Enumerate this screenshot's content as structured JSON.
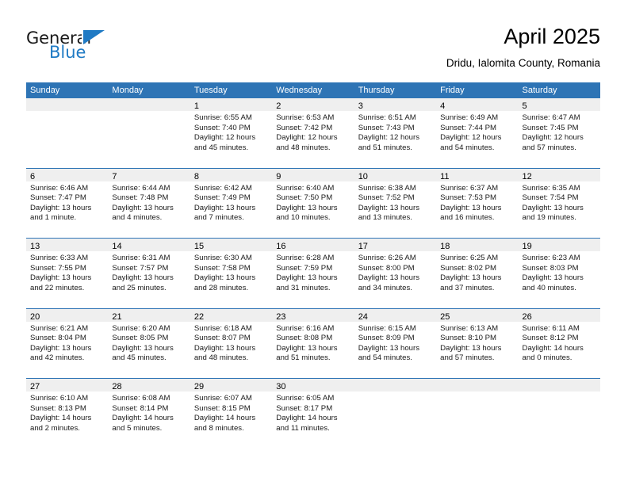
{
  "brand": {
    "name_part1": "General",
    "name_part2": "Blue",
    "accent_color": "#1f7ac4"
  },
  "header": {
    "title": "April 2025",
    "subtitle": "Dridu, Ialomita County, Romania"
  },
  "theme": {
    "header_blue": "#2e74b5",
    "day_band_gray": "#efefef"
  },
  "weekdays": [
    "Sunday",
    "Monday",
    "Tuesday",
    "Wednesday",
    "Thursday",
    "Friday",
    "Saturday"
  ],
  "weeks": [
    [
      {
        "empty": true
      },
      {
        "empty": true
      },
      {
        "day": "1",
        "sunrise": "Sunrise: 6:55 AM",
        "sunset": "Sunset: 7:40 PM",
        "daylight": "Daylight: 12 hours and 45 minutes."
      },
      {
        "day": "2",
        "sunrise": "Sunrise: 6:53 AM",
        "sunset": "Sunset: 7:42 PM",
        "daylight": "Daylight: 12 hours and 48 minutes."
      },
      {
        "day": "3",
        "sunrise": "Sunrise: 6:51 AM",
        "sunset": "Sunset: 7:43 PM",
        "daylight": "Daylight: 12 hours and 51 minutes."
      },
      {
        "day": "4",
        "sunrise": "Sunrise: 6:49 AM",
        "sunset": "Sunset: 7:44 PM",
        "daylight": "Daylight: 12 hours and 54 minutes."
      },
      {
        "day": "5",
        "sunrise": "Sunrise: 6:47 AM",
        "sunset": "Sunset: 7:45 PM",
        "daylight": "Daylight: 12 hours and 57 minutes."
      }
    ],
    [
      {
        "day": "6",
        "sunrise": "Sunrise: 6:46 AM",
        "sunset": "Sunset: 7:47 PM",
        "daylight": "Daylight: 13 hours and 1 minute."
      },
      {
        "day": "7",
        "sunrise": "Sunrise: 6:44 AM",
        "sunset": "Sunset: 7:48 PM",
        "daylight": "Daylight: 13 hours and 4 minutes."
      },
      {
        "day": "8",
        "sunrise": "Sunrise: 6:42 AM",
        "sunset": "Sunset: 7:49 PM",
        "daylight": "Daylight: 13 hours and 7 minutes."
      },
      {
        "day": "9",
        "sunrise": "Sunrise: 6:40 AM",
        "sunset": "Sunset: 7:50 PM",
        "daylight": "Daylight: 13 hours and 10 minutes."
      },
      {
        "day": "10",
        "sunrise": "Sunrise: 6:38 AM",
        "sunset": "Sunset: 7:52 PM",
        "daylight": "Daylight: 13 hours and 13 minutes."
      },
      {
        "day": "11",
        "sunrise": "Sunrise: 6:37 AM",
        "sunset": "Sunset: 7:53 PM",
        "daylight": "Daylight: 13 hours and 16 minutes."
      },
      {
        "day": "12",
        "sunrise": "Sunrise: 6:35 AM",
        "sunset": "Sunset: 7:54 PM",
        "daylight": "Daylight: 13 hours and 19 minutes."
      }
    ],
    [
      {
        "day": "13",
        "sunrise": "Sunrise: 6:33 AM",
        "sunset": "Sunset: 7:55 PM",
        "daylight": "Daylight: 13 hours and 22 minutes."
      },
      {
        "day": "14",
        "sunrise": "Sunrise: 6:31 AM",
        "sunset": "Sunset: 7:57 PM",
        "daylight": "Daylight: 13 hours and 25 minutes."
      },
      {
        "day": "15",
        "sunrise": "Sunrise: 6:30 AM",
        "sunset": "Sunset: 7:58 PM",
        "daylight": "Daylight: 13 hours and 28 minutes."
      },
      {
        "day": "16",
        "sunrise": "Sunrise: 6:28 AM",
        "sunset": "Sunset: 7:59 PM",
        "daylight": "Daylight: 13 hours and 31 minutes."
      },
      {
        "day": "17",
        "sunrise": "Sunrise: 6:26 AM",
        "sunset": "Sunset: 8:00 PM",
        "daylight": "Daylight: 13 hours and 34 minutes."
      },
      {
        "day": "18",
        "sunrise": "Sunrise: 6:25 AM",
        "sunset": "Sunset: 8:02 PM",
        "daylight": "Daylight: 13 hours and 37 minutes."
      },
      {
        "day": "19",
        "sunrise": "Sunrise: 6:23 AM",
        "sunset": "Sunset: 8:03 PM",
        "daylight": "Daylight: 13 hours and 40 minutes."
      }
    ],
    [
      {
        "day": "20",
        "sunrise": "Sunrise: 6:21 AM",
        "sunset": "Sunset: 8:04 PM",
        "daylight": "Daylight: 13 hours and 42 minutes."
      },
      {
        "day": "21",
        "sunrise": "Sunrise: 6:20 AM",
        "sunset": "Sunset: 8:05 PM",
        "daylight": "Daylight: 13 hours and 45 minutes."
      },
      {
        "day": "22",
        "sunrise": "Sunrise: 6:18 AM",
        "sunset": "Sunset: 8:07 PM",
        "daylight": "Daylight: 13 hours and 48 minutes."
      },
      {
        "day": "23",
        "sunrise": "Sunrise: 6:16 AM",
        "sunset": "Sunset: 8:08 PM",
        "daylight": "Daylight: 13 hours and 51 minutes."
      },
      {
        "day": "24",
        "sunrise": "Sunrise: 6:15 AM",
        "sunset": "Sunset: 8:09 PM",
        "daylight": "Daylight: 13 hours and 54 minutes."
      },
      {
        "day": "25",
        "sunrise": "Sunrise: 6:13 AM",
        "sunset": "Sunset: 8:10 PM",
        "daylight": "Daylight: 13 hours and 57 minutes."
      },
      {
        "day": "26",
        "sunrise": "Sunrise: 6:11 AM",
        "sunset": "Sunset: 8:12 PM",
        "daylight": "Daylight: 14 hours and 0 minutes."
      }
    ],
    [
      {
        "day": "27",
        "sunrise": "Sunrise: 6:10 AM",
        "sunset": "Sunset: 8:13 PM",
        "daylight": "Daylight: 14 hours and 2 minutes."
      },
      {
        "day": "28",
        "sunrise": "Sunrise: 6:08 AM",
        "sunset": "Sunset: 8:14 PM",
        "daylight": "Daylight: 14 hours and 5 minutes."
      },
      {
        "day": "29",
        "sunrise": "Sunrise: 6:07 AM",
        "sunset": "Sunset: 8:15 PM",
        "daylight": "Daylight: 14 hours and 8 minutes."
      },
      {
        "day": "30",
        "sunrise": "Sunrise: 6:05 AM",
        "sunset": "Sunset: 8:17 PM",
        "daylight": "Daylight: 14 hours and 11 minutes."
      },
      {
        "empty": true
      },
      {
        "empty": true
      },
      {
        "empty": true
      }
    ]
  ]
}
